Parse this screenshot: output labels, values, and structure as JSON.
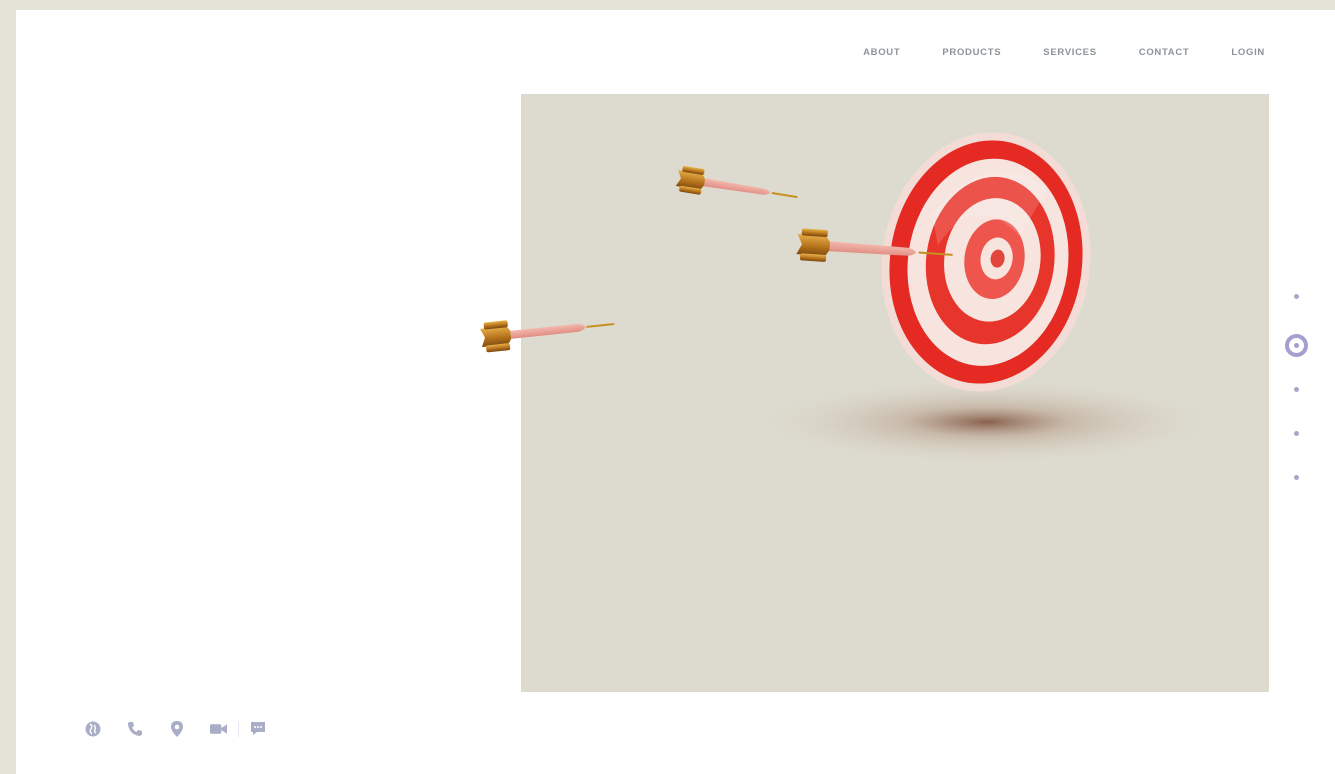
{
  "nav": {
    "items": [
      {
        "label": "ABOUT",
        "id": "about"
      },
      {
        "label": "PRODUCTS",
        "id": "products"
      },
      {
        "label": "SERVICES",
        "id": "services"
      },
      {
        "label": "CONTACT",
        "id": "contact"
      },
      {
        "label": "LOGIN",
        "id": "login"
      }
    ]
  },
  "slider": {
    "total": 5,
    "active_index": 1
  },
  "contacts": {
    "icons": [
      "globe-icon",
      "phone-icon",
      "location-pin-icon",
      "video-camera-icon",
      "chat-icon"
    ]
  },
  "colors": {
    "page_bg": "#e4e3d8",
    "hero_bg": "#dddbcf",
    "nav_text": "#8c9499",
    "accent": "#a39fcf",
    "icon": "#a9aec6"
  }
}
